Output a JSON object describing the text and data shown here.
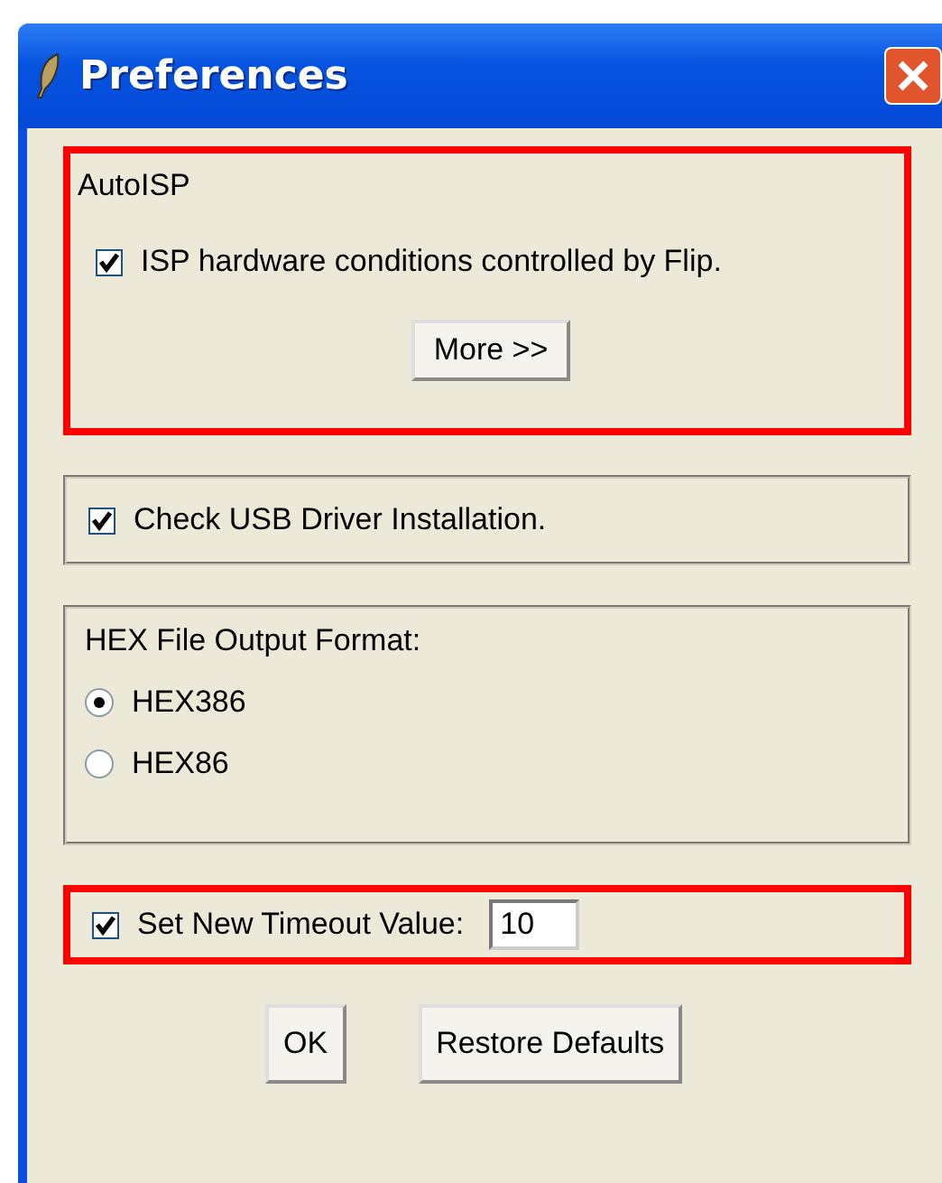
{
  "window": {
    "title": "Preferences"
  },
  "groups": [
    {
      "kind": "autoisp",
      "title": "AutoISP",
      "highlighted": true,
      "checkbox": {
        "label": "ISP hardware conditions controlled by Flip.",
        "checked": true
      },
      "button": "More >>"
    },
    {
      "kind": "check",
      "highlighted": false,
      "checkbox": {
        "label": "Check USB Driver Installation.",
        "checked": true
      }
    },
    {
      "kind": "radio",
      "title": "HEX File Output Format:",
      "highlighted": false,
      "options": [
        {
          "label": "HEX386",
          "selected": true
        },
        {
          "label": "HEX86",
          "selected": false
        }
      ]
    },
    {
      "kind": "timeout",
      "highlighted": true,
      "checkbox": {
        "label": "Set New Timeout Value:",
        "checked": true
      },
      "value": "10"
    }
  ],
  "buttons": [
    "OK",
    "Restore Defaults"
  ]
}
